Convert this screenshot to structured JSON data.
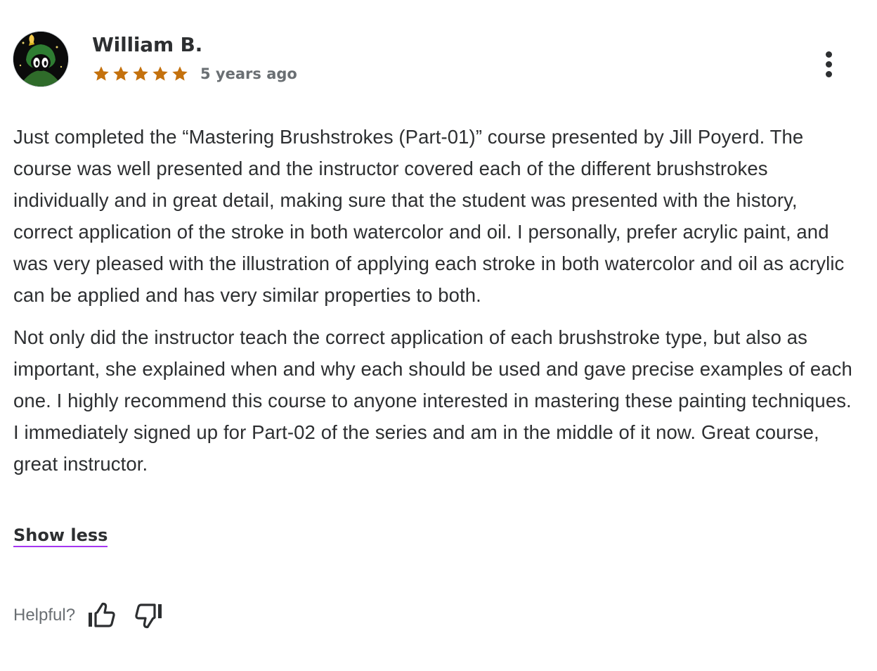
{
  "review": {
    "author": "William B.",
    "avatar_icon": "avatar-cartoon-icon",
    "rating": 5,
    "rating_max": 5,
    "star_color": "#c4710d",
    "time_ago": "5 years ago",
    "paragraphs": [
      "Just completed the “Mastering Brushstrokes (Part-01)” course presented by Jill Poyerd. The course was well presented and the instructor covered each of the different brushstrokes individually and in great detail, making sure that the student was presented with the history, correct application of the stroke in both watercolor and oil. I personally, prefer acrylic paint, and was very pleased with the illustration of applying each stroke in both watercolor and oil as acrylic can be applied and has very similar properties to both.",
      "Not only did the instructor teach the correct application of each brushstroke type, but also as important, she explained when and why each should be used and gave precise examples of each one. I highly recommend this course to anyone interested in mastering these painting techniques. I immediately signed up for Part-02 of the series and am in the middle of it now. Great course, great instructor."
    ],
    "show_less_label": "Show less",
    "helpful_label": "Helpful?",
    "menu_icon": "more-vertical-icon",
    "thumbs_up_icon": "thumbs-up-icon",
    "thumbs_down_icon": "thumbs-down-icon",
    "link_underline_color": "#a435f0"
  }
}
